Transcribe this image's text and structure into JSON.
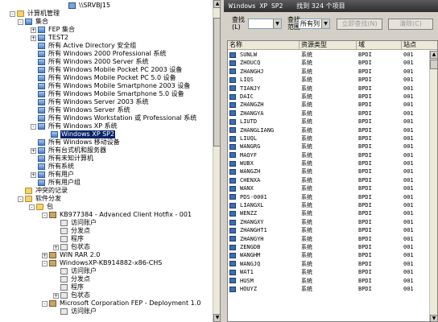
{
  "tree": {
    "items": [
      {
        "label": "\\\\SRVBJ15",
        "exp": "",
        "icon": "comp"
      },
      {
        "label": "计算机管理",
        "exp": "-",
        "icon": "folder"
      },
      {
        "label": "集合",
        "exp": "-",
        "icon": "coll"
      },
      {
        "label": "FEP 集合",
        "exp": "+",
        "icon": "coll"
      },
      {
        "label": "TEST2",
        "exp": "+",
        "icon": "coll"
      },
      {
        "label": "所有 Active Directory 安全组",
        "exp": "",
        "icon": "coll"
      },
      {
        "label": "所有 Windows 2000 Professional 系统",
        "exp": "",
        "icon": "coll"
      },
      {
        "label": "所有 Windows 2000 Server 系统",
        "exp": "",
        "icon": "coll"
      },
      {
        "label": "所有 Windows Mobile Pocket PC 2003 设备",
        "exp": "",
        "icon": "coll"
      },
      {
        "label": "所有 Windows Mobile Pocket PC 5.0 设备",
        "exp": "",
        "icon": "coll"
      },
      {
        "label": "所有 Windows Mobile Smartphone 2003 设备",
        "exp": "",
        "icon": "coll"
      },
      {
        "label": "所有 Windows Mobile Smartphone 5.0 设备",
        "exp": "",
        "icon": "coll"
      },
      {
        "label": "所有 Windows Server 2003 系统",
        "exp": "",
        "icon": "coll"
      },
      {
        "label": "所有 Windows Server 系统",
        "exp": "",
        "icon": "coll"
      },
      {
        "label": "所有 Windows Workstation 或 Professional 系统",
        "exp": "",
        "icon": "coll"
      },
      {
        "label": "所有 Windows XP 系统",
        "exp": "-",
        "icon": "coll"
      },
      {
        "label": "Windows XP SP2",
        "exp": "",
        "icon": "coll"
      },
      {
        "label": "所有 Windows 移动设备",
        "exp": "",
        "icon": "coll"
      },
      {
        "label": "所有台式机和服务器",
        "exp": "+",
        "icon": "coll"
      },
      {
        "label": "所有未知计算机",
        "exp": "",
        "icon": "coll"
      },
      {
        "label": "所有系统",
        "exp": "",
        "icon": "coll"
      },
      {
        "label": "所有用户",
        "exp": "+",
        "icon": "coll"
      },
      {
        "label": "所有用户组",
        "exp": "",
        "icon": "coll"
      },
      {
        "label": "冲突的记录",
        "exp": "",
        "icon": "folder"
      },
      {
        "label": "软件分发",
        "exp": "-",
        "icon": "folder"
      },
      {
        "label": "包",
        "exp": "-",
        "icon": "folder"
      },
      {
        "label": "KB977384 - Advanced Client Hotfix - 001",
        "exp": "-",
        "icon": "pkg"
      },
      {
        "label": "访问账户",
        "exp": "",
        "icon": "node"
      },
      {
        "label": "分发点",
        "exp": "",
        "icon": "node"
      },
      {
        "label": "程序",
        "exp": "",
        "icon": "node"
      },
      {
        "label": "包状态",
        "exp": "+",
        "icon": "node"
      },
      {
        "label": "WIN RAR 2.0",
        "exp": "+",
        "icon": "pkg"
      },
      {
        "label": "WindowsXP-KB914882-x86-CHS",
        "exp": "-",
        "icon": "pkg"
      },
      {
        "label": "访问账户",
        "exp": "",
        "icon": "node"
      },
      {
        "label": "分发点",
        "exp": "",
        "icon": "node"
      },
      {
        "label": "程序",
        "exp": "",
        "icon": "node"
      },
      {
        "label": "包状态",
        "exp": "+",
        "icon": "node"
      },
      {
        "label": "Microsoft Corporation FEP - Deployment 1.0",
        "exp": "-",
        "icon": "pkg"
      },
      {
        "label": "访问账户",
        "exp": "",
        "icon": "node"
      }
    ]
  },
  "right": {
    "title": "Windows XP SP2",
    "count_text": "找到 324 个项目",
    "search": {
      "find_label_1": "查找",
      "find_label_2": "(L)",
      "field_value": "",
      "in_label_1": "查找",
      "in_label_2": "范围",
      "in_value": "所有列",
      "find_now": "立即查找(N)",
      "clear": "清除(C)"
    },
    "columns": [
      "名称",
      "资源类型",
      "域",
      "站点"
    ],
    "rows": [
      [
        "SUNLW",
        "系统",
        "BPDI",
        "001"
      ],
      [
        "ZHOUCQ",
        "系统",
        "BPDI",
        "001"
      ],
      [
        "ZHANGHJ",
        "系统",
        "BPDI",
        "001"
      ],
      [
        "LIQS",
        "系统",
        "BPDI",
        "001"
      ],
      [
        "TIANJY",
        "系统",
        "BPDI",
        "001"
      ],
      [
        "DAIC",
        "系统",
        "BPDI",
        "001"
      ],
      [
        "ZHANGZH",
        "系统",
        "BPDI",
        "001"
      ],
      [
        "ZHANGYA",
        "系统",
        "BPDI",
        "001"
      ],
      [
        "LIUTD",
        "系统",
        "BPDI",
        "001"
      ],
      [
        "ZHANGLIANG",
        "系统",
        "BPDI",
        "001"
      ],
      [
        "LIUQL",
        "系统",
        "BPDI",
        "001"
      ],
      [
        "WANGRG",
        "系统",
        "BPDI",
        "001"
      ],
      [
        "MAOYF",
        "系统",
        "BPDI",
        "001"
      ],
      [
        "WUBX",
        "系统",
        "BPDI",
        "001"
      ],
      [
        "WANGZH",
        "系统",
        "BPDI",
        "001"
      ],
      [
        "CHENXA",
        "系统",
        "BPDI",
        "001"
      ],
      [
        "WANX",
        "系统",
        "BPDI",
        "001"
      ],
      [
        "PDS-0001",
        "系统",
        "BPDI",
        "001"
      ],
      [
        "LIANGXL",
        "系统",
        "BPDI",
        "001"
      ],
      [
        "WENZZ",
        "系统",
        "BPDI",
        "001"
      ],
      [
        "ZHANGXY",
        "系统",
        "BPDI",
        "001"
      ],
      [
        "ZHANGHT1",
        "系统",
        "BPDI",
        "001"
      ],
      [
        "ZHANGYH",
        "系统",
        "BPDI",
        "001"
      ],
      [
        "ZENGDB",
        "系统",
        "BPDI",
        "001"
      ],
      [
        "WANGHM",
        "系统",
        "BPDI",
        "001"
      ],
      [
        "WANGJQ",
        "系统",
        "BPDI",
        "001"
      ],
      [
        "WAT1",
        "系统",
        "BPDI",
        "001"
      ],
      [
        "HUSM",
        "系统",
        "BPDI",
        "001"
      ],
      [
        "HOUYZ",
        "系统",
        "BPDI",
        "001"
      ]
    ]
  }
}
